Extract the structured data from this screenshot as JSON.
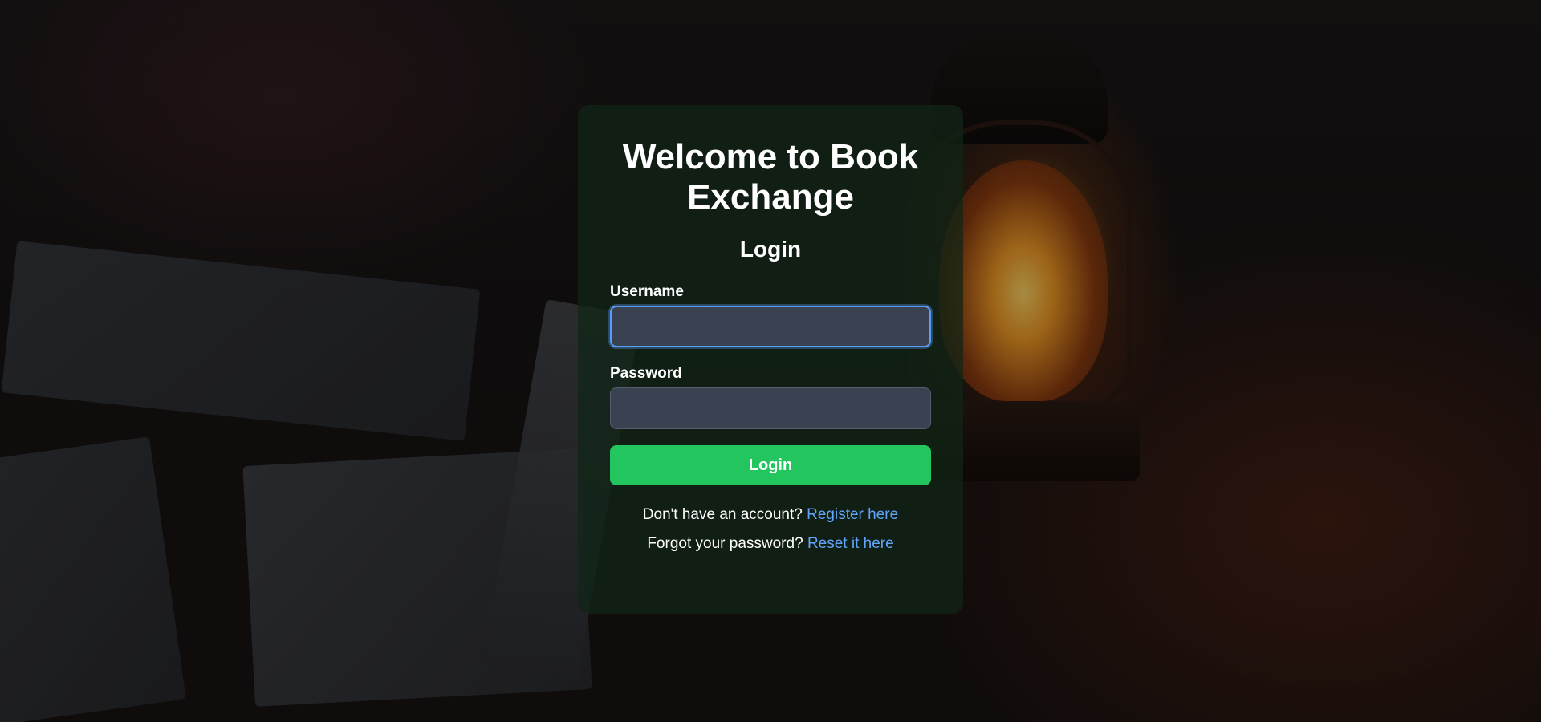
{
  "card": {
    "title": "Welcome to Book Exchange",
    "subtitle": "Login"
  },
  "form": {
    "username_label": "Username",
    "username_value": "",
    "password_label": "Password",
    "password_value": "",
    "submit_label": "Login"
  },
  "links": {
    "register_prompt": "Don't have an account?",
    "register_link": "Register here",
    "reset_prompt": "Forgot your password?",
    "reset_link": "Reset it here"
  },
  "colors": {
    "accent": "#22c55e",
    "link": "#60a5fa",
    "focus_ring": "#5b9cf5",
    "input_bg": "#3a4252"
  }
}
